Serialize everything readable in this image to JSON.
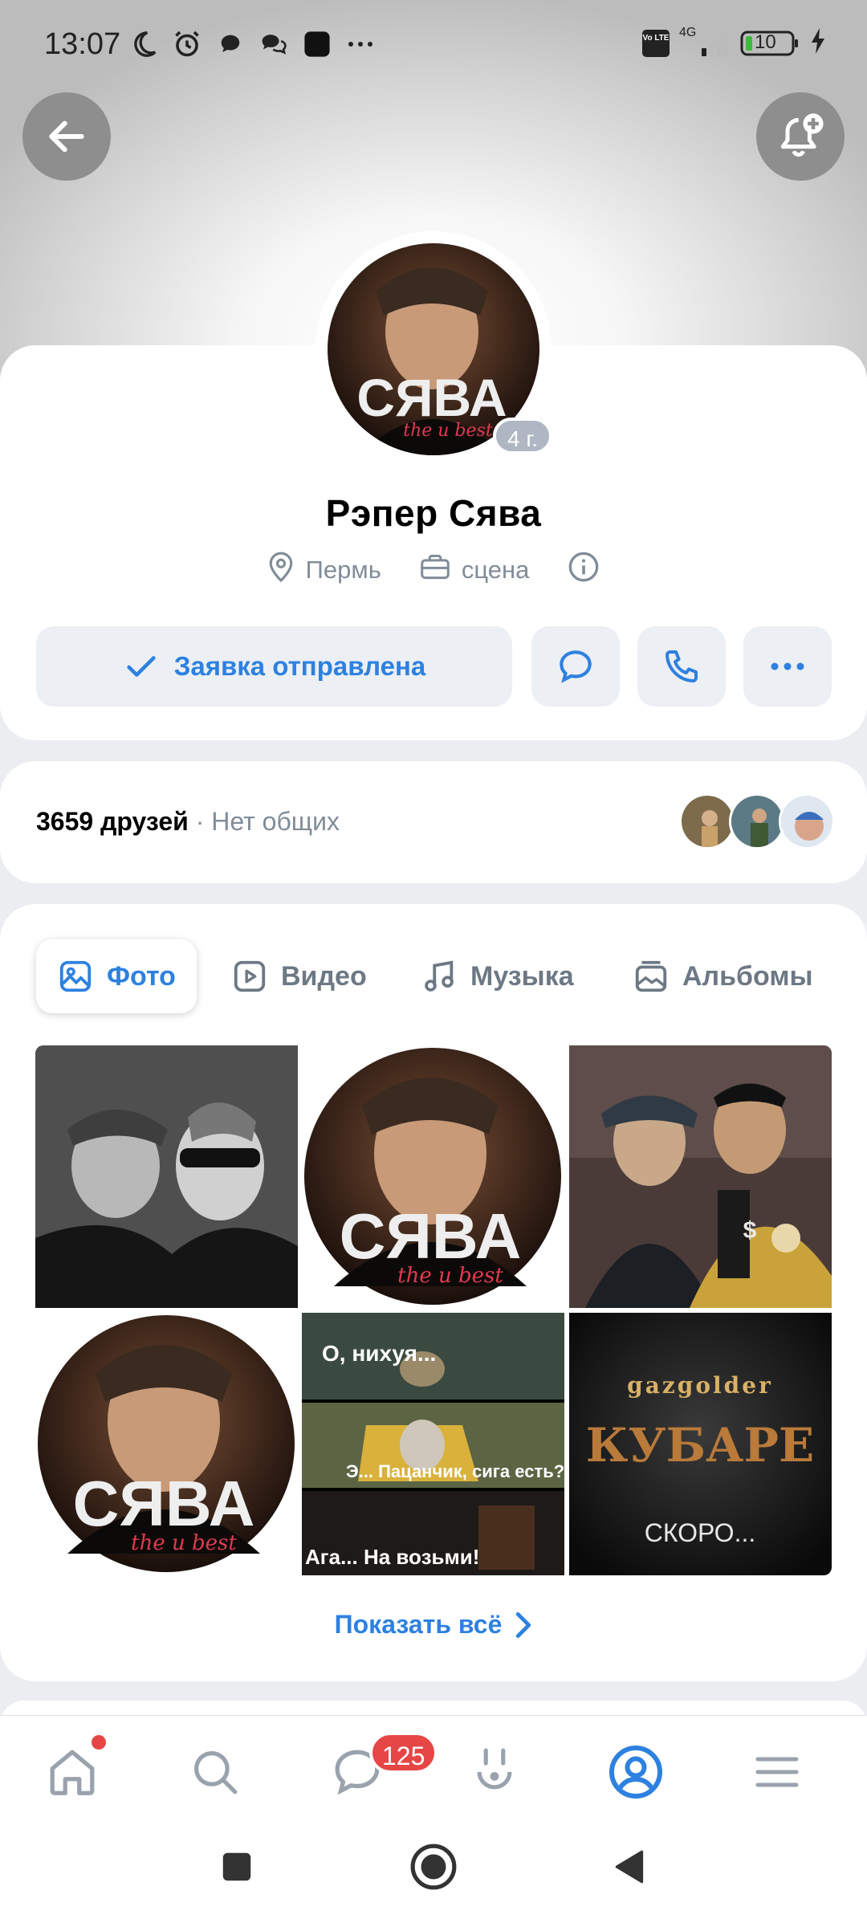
{
  "status_bar": {
    "time": "13:07",
    "network": "4G",
    "battery": "10",
    "volte": "Vo LTE"
  },
  "profile": {
    "name": "Рэпер Сява",
    "age_badge": "4 г.",
    "city": "Пермь",
    "work": "сцена",
    "avatar_logo": "СЯВА",
    "avatar_tagline": "the u best"
  },
  "actions": {
    "request_sent_label": "Заявка отправлена"
  },
  "friends": {
    "count_label": "3659 друзей",
    "separator": " · ",
    "mutual_label": "Нет общих"
  },
  "media_tabs": [
    {
      "label": "Фото",
      "active": true
    },
    {
      "label": "Видео",
      "active": false
    },
    {
      "label": "Музыка",
      "active": false
    },
    {
      "label": "Альбомы",
      "active": false
    }
  ],
  "photos": {
    "meme_lines": [
      "О, нихуя...",
      "Э... Пацанчик, сига есть?",
      "Ага... На возьми!"
    ],
    "poster_brand": "gazgolder",
    "poster_title": "КУБАРЕ",
    "poster_soon": "СКОРО...",
    "avatar_logo": "СЯВА",
    "avatar_tagline": "the u best"
  },
  "show_all_label": "Показать всё",
  "bottom_nav": {
    "messages_badge": "125"
  },
  "colors": {
    "accent": "#2d81e0",
    "muted": "#818c99",
    "badge_red": "#e64646"
  }
}
